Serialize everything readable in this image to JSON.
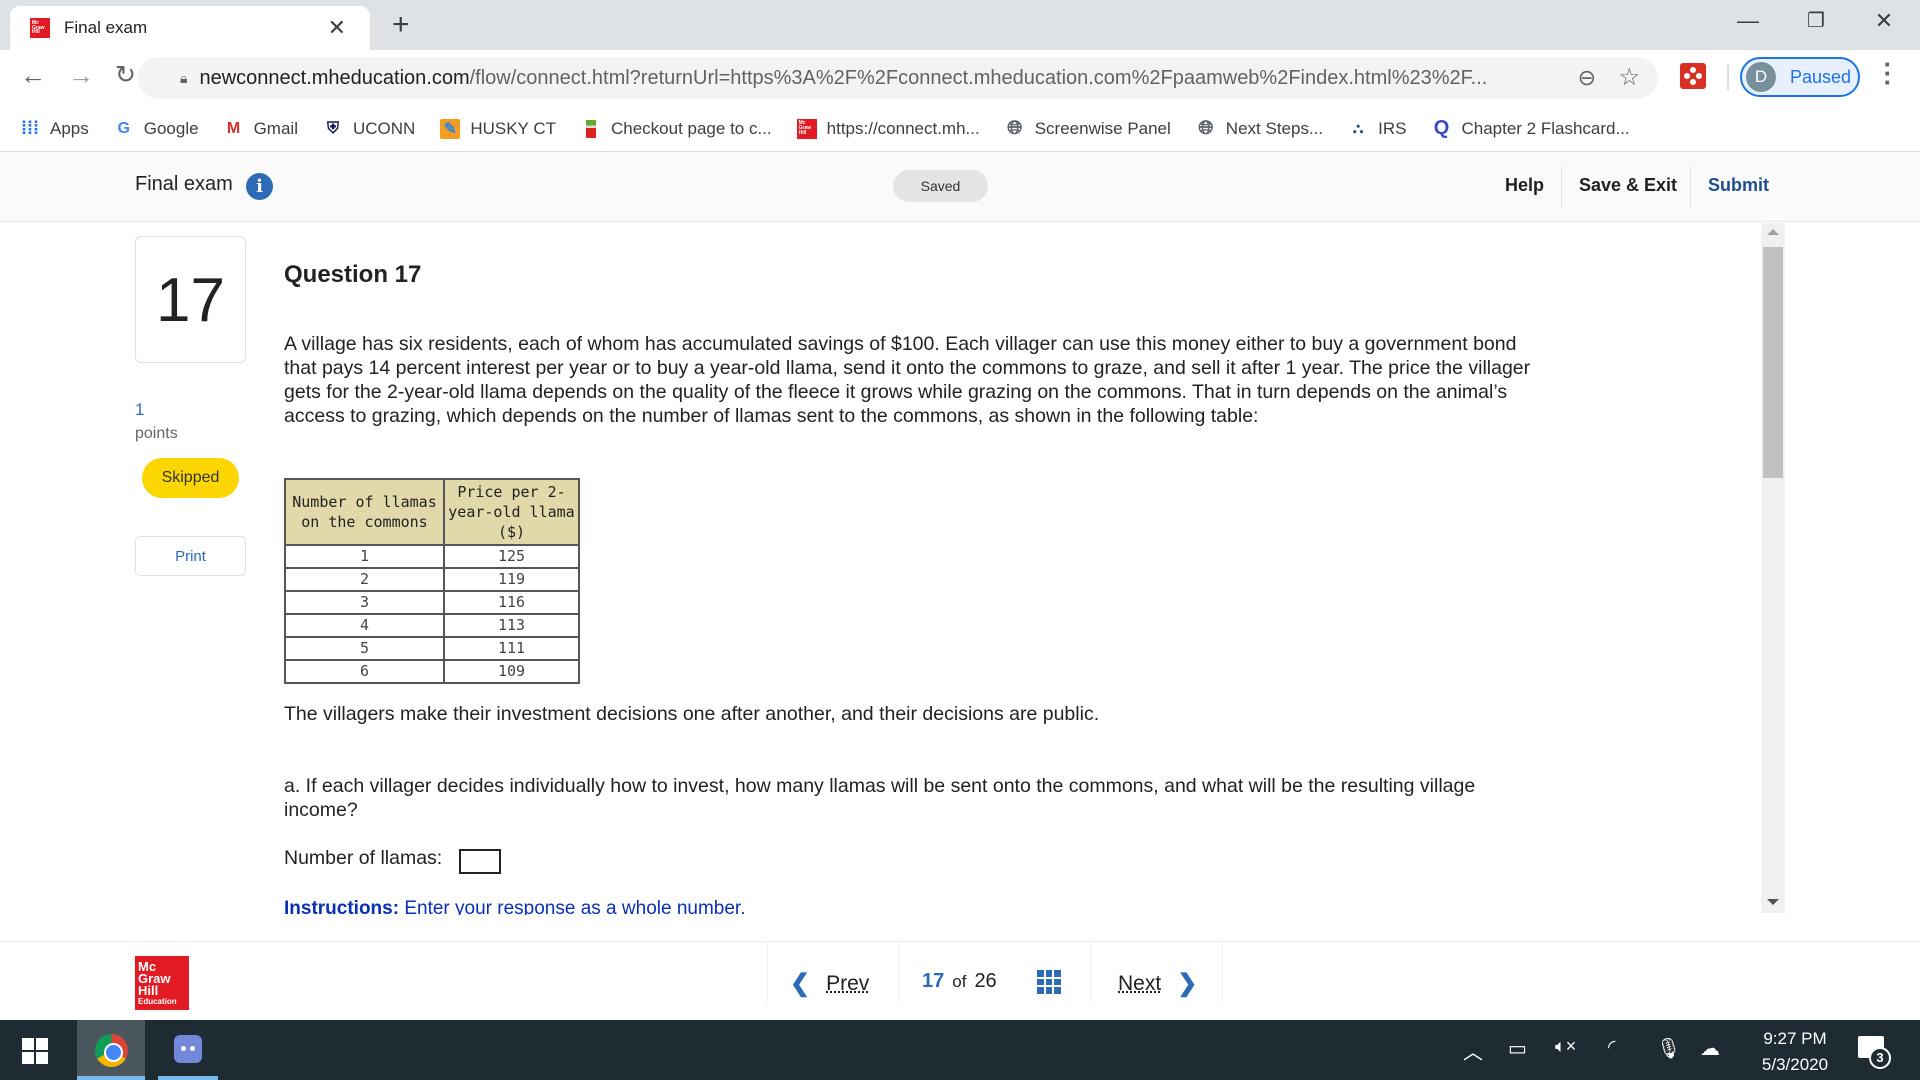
{
  "browser": {
    "tab_title": "Final exam",
    "new_tab_label": "+",
    "url_host": "newconnect.mheducation.com",
    "url_rest": "/flow/connect.html?returnUrl=https%3A%2F%2Fconnect.mheducation.com%2Fpaamweb%2Findex.html%23%2F...",
    "profile_initial": "D",
    "profile_status": "Paused",
    "bookmarks": [
      {
        "label": "Apps",
        "icon": "apps-grid-icon"
      },
      {
        "label": "Google",
        "icon": "google-icon"
      },
      {
        "label": "Gmail",
        "icon": "gmail-icon"
      },
      {
        "label": "UCONN",
        "icon": "uconn-icon"
      },
      {
        "label": "HUSKY CT",
        "icon": "pencil-icon"
      },
      {
        "label": "Checkout page to c...",
        "icon": "checkout-icon"
      },
      {
        "label": "https://connect.mh...",
        "icon": "mcgraw-hill-icon"
      },
      {
        "label": "Screenwise Panel",
        "icon": "globe-icon"
      },
      {
        "label": "Next Steps...",
        "icon": "globe-icon"
      },
      {
        "label": "IRS",
        "icon": "irs-icon"
      },
      {
        "label": "Chapter 2 Flashcard...",
        "icon": "quizlet-icon"
      }
    ]
  },
  "header": {
    "exam_title": "Final exam",
    "save_status": "Saved",
    "help": "Help",
    "save_exit": "Save & Exit",
    "submit": "Submit"
  },
  "sidebar": {
    "question_number": "17",
    "points_value": "1",
    "points_label": "points",
    "status_badge": "Skipped",
    "print_label": "Print"
  },
  "question": {
    "title": "Question 17",
    "body": "A village has six residents, each of whom has accumulated savings of $100. Each villager can use this money either to buy a government bond that pays 14 percent interest per year or to buy a year-old llama, send it onto the commons to graze, and sell it after 1 year. The price the villager gets for the 2-year-old llama depends on the quality of the fleece it grows while grazing on the commons. That in turn depends on the animal’s access to grazing, which depends on the number of llamas sent to the commons, as shown in the following table:",
    "table": {
      "headers": [
        "Number of llamas on the commons",
        "Price per 2-year-old llama ($)"
      ],
      "rows": [
        [
          "1",
          "125"
        ],
        [
          "2",
          "119"
        ],
        [
          "3",
          "116"
        ],
        [
          "4",
          "113"
        ],
        [
          "5",
          "111"
        ],
        [
          "6",
          "109"
        ]
      ]
    },
    "note": "The villagers make their investment decisions one after another, and their decisions are public.",
    "part_a": "a. If each villager decides individually how to invest, how many llamas will be sent onto the commons, and what will be the resulting village income?",
    "llamas_label": "Number of llamas:",
    "llamas_value": "",
    "instructions_label": "Instructions:",
    "instructions_text": "Enter your response as a whole number."
  },
  "footer": {
    "prev": "Prev",
    "next": "Next",
    "current_page": "17",
    "of_label": "of",
    "total_pages": "26",
    "logo_lines": [
      "Mc",
      "Graw",
      "Hill",
      "Education"
    ]
  },
  "taskbar": {
    "time": "9:27 PM",
    "date": "5/3/2020",
    "notification_count": "3"
  },
  "colors": {
    "accent_blue": "#2e6bb7",
    "skipped_yellow": "#fcd600",
    "table_header": "#e2d9aa",
    "brand_red": "#e21a23",
    "instructions_blue": "#0a2fb5"
  }
}
